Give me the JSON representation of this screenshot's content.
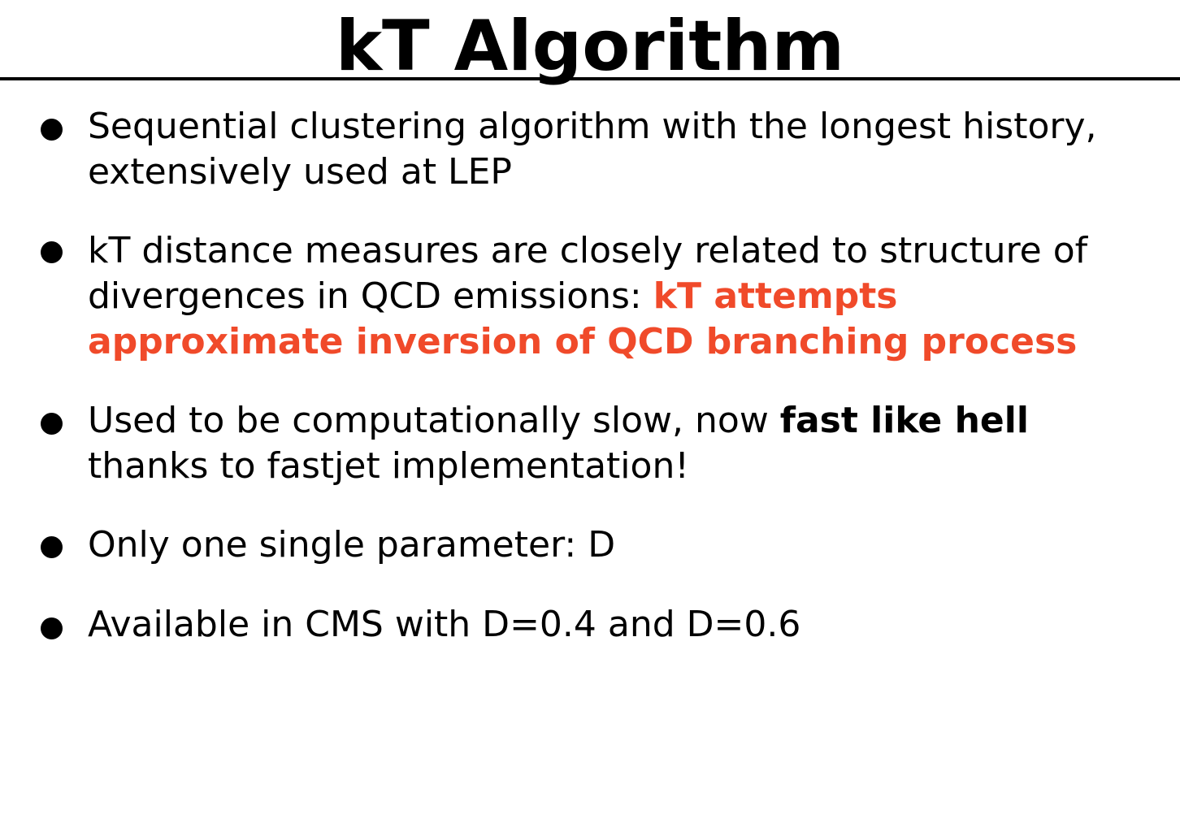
{
  "title": "kT Algorithm",
  "bullets": [
    {
      "text": "Sequential clustering algorithm with the longest history, extensively used at LEP"
    },
    {
      "text": "kT distance measures are closely related to structure of divergences in QCD emissions: ",
      "highlight": "kT attempts approximate inversion of QCD branching process",
      "highlight_color": "#f04a2a"
    },
    {
      "text": "Used to be computationally slow, now ",
      "emphasis": "fast like hell",
      "text_after": " thanks to fastjet implementation!"
    },
    {
      "text": "Only one single parameter: D"
    },
    {
      "text": "Available in CMS with D=0.4 and D=0.6"
    }
  ]
}
